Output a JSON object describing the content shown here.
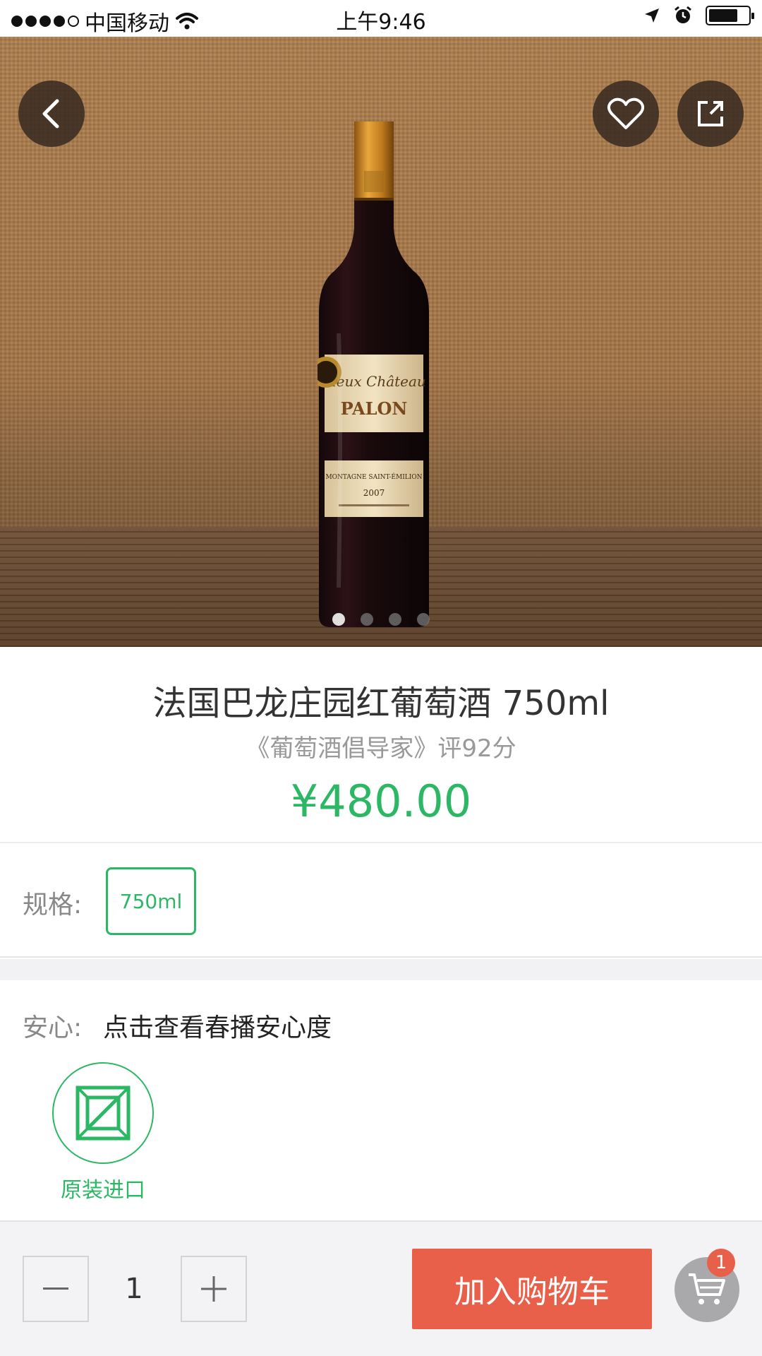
{
  "status_bar": {
    "carrier": "中国移动",
    "time": "上午9:46"
  },
  "hero": {
    "image_count": 4,
    "active_index": 0,
    "bottle_label": {
      "script": "Vieux Château",
      "brand": "PALON",
      "appellation": "MONTAGNE SAINT-ÉMILION",
      "vintage": "2007"
    }
  },
  "product": {
    "name": "法国巴龙庄园红葡萄酒 750ml",
    "rating": "《葡萄酒倡导家》评92分",
    "price": "¥480.00"
  },
  "spec": {
    "label": "规格:",
    "selected": "750ml"
  },
  "assurance": {
    "label": "安心:",
    "link": "点击查看春播安心度",
    "badge_label": "原装进口"
  },
  "cart": {
    "quantity": "1",
    "add_label": "加入购物车",
    "badge_count": "1"
  },
  "colors": {
    "accent_green": "#2bb764",
    "cta_red": "#e8604a"
  }
}
